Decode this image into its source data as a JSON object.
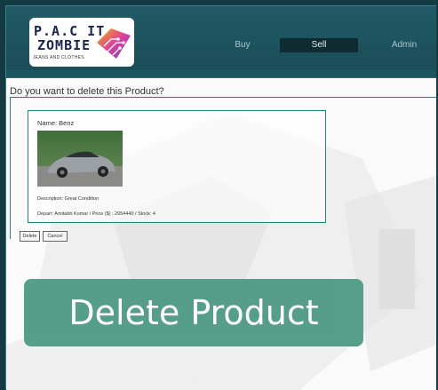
{
  "logo": {
    "line1": "P.A.C IT",
    "line2": "ZOMBIE",
    "line3": "JEANS AND CLOTHES"
  },
  "nav": {
    "items": [
      {
        "label": "Buy"
      },
      {
        "label": "Sell"
      },
      {
        "label": "Admin"
      }
    ],
    "active": "Sell"
  },
  "page": {
    "title": "Do you want to delete this Product?"
  },
  "product": {
    "name": "Name: Benz",
    "description": "Description: Great Condition",
    "meta": "Depart: Amitabh Kumar / Price ($) : 2954440 / Stock: 4"
  },
  "buttons": {
    "delete": "Delete",
    "cancel": "Cancel"
  },
  "banner": {
    "text": "Delete Product"
  },
  "colors": {
    "header": "#1d5560",
    "accent": "#2c7d7d",
    "banner": "#4f9a85",
    "active_nav": "#0e2b31"
  }
}
